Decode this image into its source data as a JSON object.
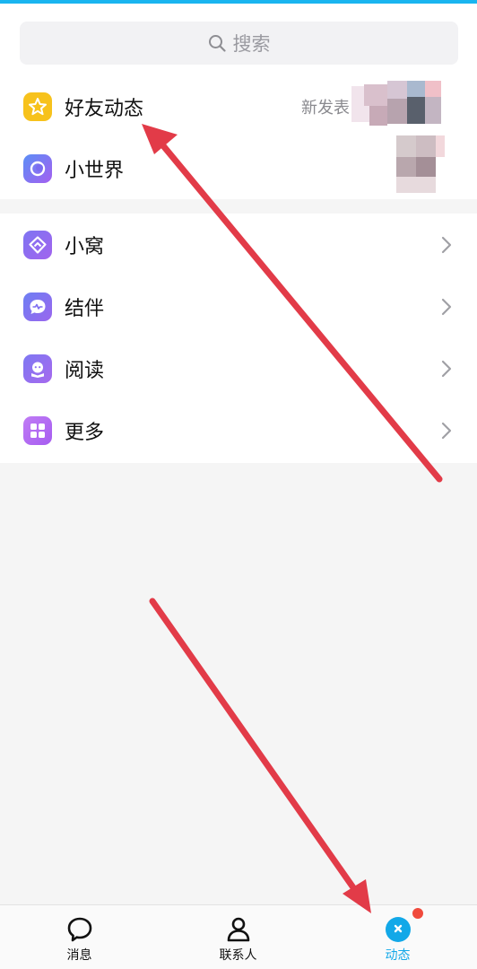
{
  "colors": {
    "accent": "#19b5f0",
    "annotation_arrow": "#e23b48",
    "active_tab": "#12a8e8",
    "badge": "#f04a3c"
  },
  "search": {
    "placeholder": "搜索",
    "icon": "search-icon"
  },
  "group1": [
    {
      "label": "好友动态",
      "icon": "star-icon",
      "icon_color": "#f7c21c",
      "right_text": "新发表"
    },
    {
      "label": "小世界",
      "icon": "planet-icon",
      "icon_color": "#7a6cf0"
    }
  ],
  "group2": [
    {
      "label": "小窝",
      "icon": "house-icon",
      "icon_color": "#8a6cf3"
    },
    {
      "label": "结伴",
      "icon": "chat-pulse-icon",
      "icon_color": "#7c6cf2"
    },
    {
      "label": "阅读",
      "icon": "reading-icon",
      "icon_color": "#8f73f0"
    },
    {
      "label": "更多",
      "icon": "grid-icon",
      "icon_color": "#b36ef5"
    }
  ],
  "tabs": [
    {
      "label": "消息",
      "icon": "chat-bubble-icon",
      "active": false
    },
    {
      "label": "联系人",
      "icon": "person-icon",
      "active": false
    },
    {
      "label": "动态",
      "icon": "star-circle-icon",
      "active": true,
      "badge": true
    }
  ]
}
